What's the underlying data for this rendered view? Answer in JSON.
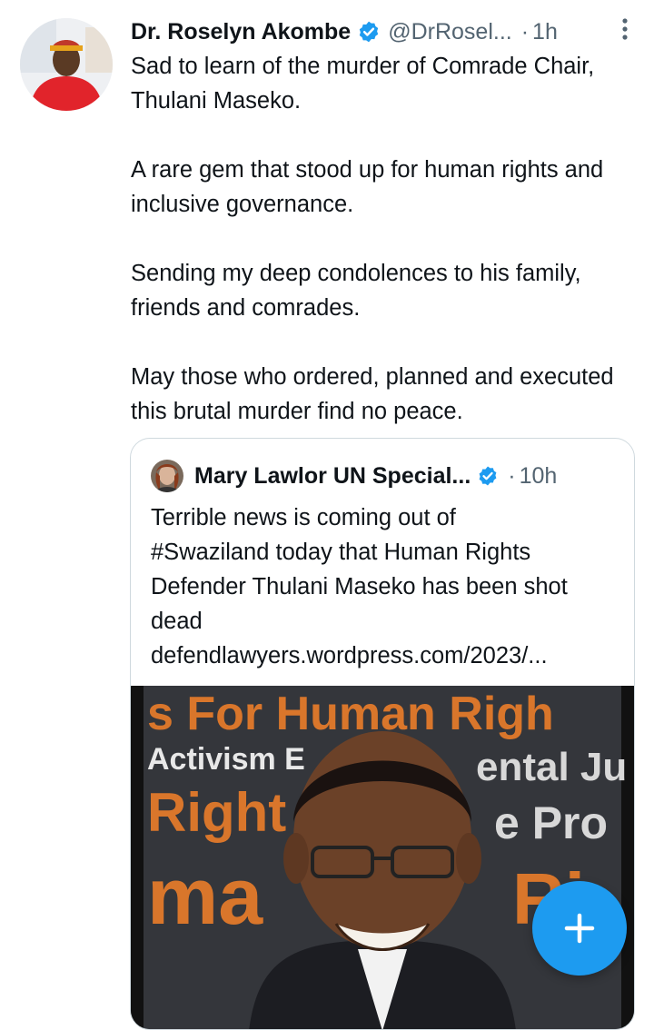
{
  "tweet": {
    "author_name": "Dr. Roselyn Akombe",
    "handle": "@DrRosel...",
    "separator": "·",
    "time": "1h",
    "paragraphs": [
      "Sad to learn of the murder of Comrade Chair, Thulani Maseko.",
      "A rare gem that stood up for human rights and inclusive governance.",
      "Sending my deep condolences to his family, friends and comrades.",
      "May those who ordered, planned and executed this brutal murder find no peace."
    ]
  },
  "quoted_tweet": {
    "author_name": "Mary Lawlor UN Special...",
    "separator": "·",
    "time": "10h",
    "text_lines": [
      "Terrible news is coming out of",
      "#Swaziland today that Human Rights",
      "Defender Thulani Maseko has been shot",
      "dead",
      "defendlawyers.wordpress.com/2023/..."
    ],
    "image_overlay_words": [
      "s For Human Righ",
      "Activism E",
      "ental Ju",
      "Right",
      "e Pro",
      "ma",
      "Ri"
    ]
  },
  "icons": {
    "verified": "verified-badge-icon",
    "more": "more-vertical-icon",
    "compose": "plus-icon"
  },
  "colors": {
    "accent": "#1d9bf0",
    "text": "#0f1419",
    "secondary": "#536471",
    "border": "#cfd9de"
  }
}
